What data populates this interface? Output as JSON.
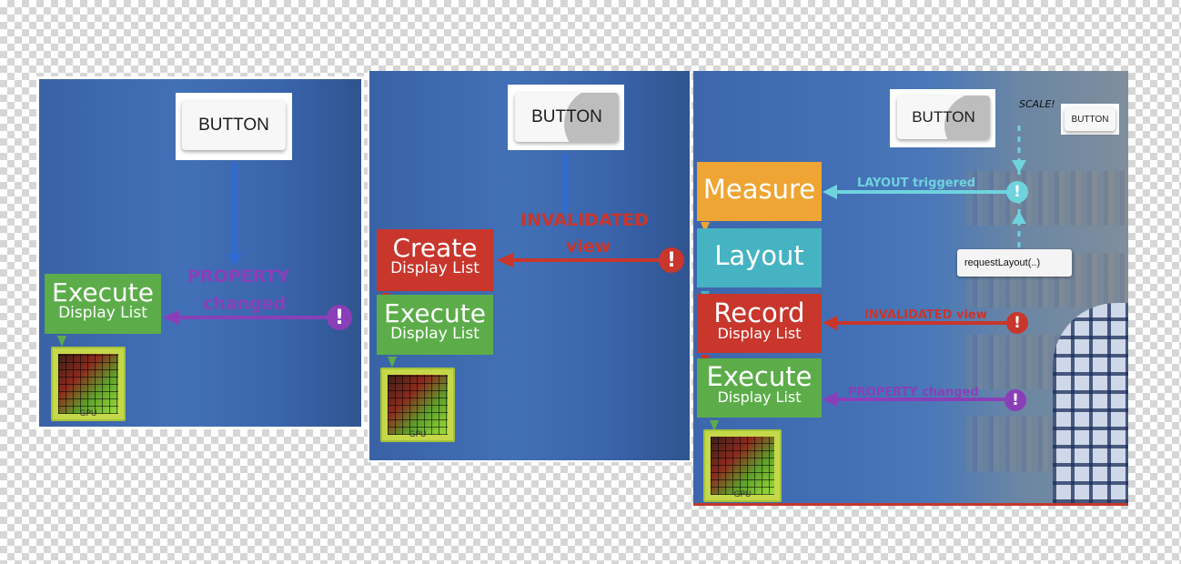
{
  "panels": [
    {
      "button_label": "BUTTON",
      "trigger_label_line1": "PROPERTY",
      "trigger_label_line2": "changed",
      "steps": [
        {
          "title": "Execute",
          "subtitle": "Display List"
        }
      ],
      "gpu_label": "GPU"
    },
    {
      "button_label": "BUTTON",
      "trigger_label_line1": "INVALIDATED",
      "trigger_label_line2": "view",
      "steps": [
        {
          "title": "Create",
          "subtitle": "Display List"
        },
        {
          "title": "Execute",
          "subtitle": "Display List"
        }
      ],
      "gpu_label": "GPU"
    },
    {
      "button_label": "BUTTON",
      "scaled_button_label": "BUTTON",
      "scale_label": "SCALE!",
      "request_layout_label": "requestLayout(..)",
      "triggers": {
        "layout": "LAYOUT triggered",
        "invalidated": "INVALIDATED view",
        "property": "PROPERTY changed"
      },
      "steps": [
        {
          "title": "Measure"
        },
        {
          "title": "Layout"
        },
        {
          "title": "Record",
          "subtitle": "Display List"
        },
        {
          "title": "Execute",
          "subtitle": "Display List"
        }
      ],
      "gpu_label": "GPU"
    }
  ],
  "colors": {
    "execute_green": "#5cad4a",
    "invalidate_red": "#c8362c",
    "measure_orange": "#eea533",
    "layout_teal": "#46b3c2",
    "property_purple": "#8a3fb8",
    "layout_trigger_cyan": "#6fd3de",
    "button_flow_blue": "#2f6bd4"
  }
}
